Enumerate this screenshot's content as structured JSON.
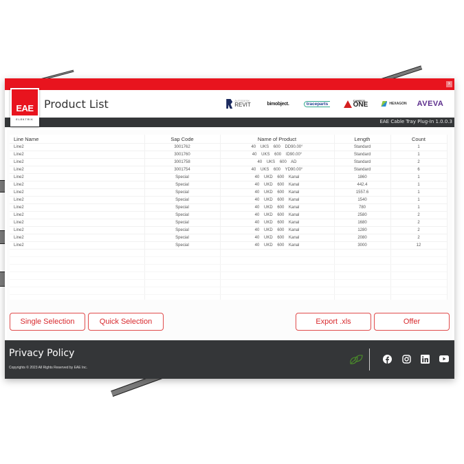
{
  "window": {
    "close_label": "x"
  },
  "header": {
    "logo_text": "EAE",
    "logo_subtext": "ELEKTRIK",
    "title": "Product List",
    "partners": {
      "revit_small": "AUTODESK",
      "revit_big": "REVIT",
      "bimobject": "bimobject.",
      "traceparts": "traceparts",
      "caneco_small": "CANECO",
      "caneco_big": "ONE",
      "hexagon": "HEXAGON",
      "aveva": "AVEVA"
    },
    "version": "EAE Cable Tray Plug-In 1.0.0.3"
  },
  "table": {
    "columns": [
      "Line Name",
      "Sap Code",
      "Name of Product",
      "Length",
      "Count"
    ],
    "rows": [
      {
        "line": "Line2",
        "sap": "3001762",
        "product": "40    UKS    600    DD90.00°",
        "length": "Standard",
        "count": "1"
      },
      {
        "line": "Line2",
        "sap": "3001760",
        "product": "40    UKS    600    ID90.00°",
        "length": "Standard",
        "count": "1"
      },
      {
        "line": "Line2",
        "sap": "3001758",
        "product": "40    UKS    600    AD",
        "length": "Standard",
        "count": "2"
      },
      {
        "line": "Line2",
        "sap": "3001754",
        "product": "40    UKS    600    YD90.00°",
        "length": "Standard",
        "count": "6"
      },
      {
        "line": "Line2",
        "sap": "Special",
        "product": "40    UKD    600    Kanal",
        "length": "1860",
        "count": "1"
      },
      {
        "line": "Line2",
        "sap": "Special",
        "product": "40    UKD    600    Kanal",
        "length": "442.4",
        "count": "1"
      },
      {
        "line": "Line2",
        "sap": "Special",
        "product": "40    UKD    600    Kanal",
        "length": "1557.6",
        "count": "1"
      },
      {
        "line": "Line2",
        "sap": "Special",
        "product": "40    UKD    600    Kanal",
        "length": "1540",
        "count": "1"
      },
      {
        "line": "Line2",
        "sap": "Special",
        "product": "40    UKD    600    Kanal",
        "length": "780",
        "count": "1"
      },
      {
        "line": "Line2",
        "sap": "Special",
        "product": "40    UKD    600    Kanal",
        "length": "2580",
        "count": "2"
      },
      {
        "line": "Line2",
        "sap": "Special",
        "product": "40    UKD    600    Kanal",
        "length": "1680",
        "count": "2"
      },
      {
        "line": "Line2",
        "sap": "Special",
        "product": "40    UKD    600    Kanal",
        "length": "1280",
        "count": "2"
      },
      {
        "line": "Line2",
        "sap": "Special",
        "product": "40    UKD    600    Kanal",
        "length": "2080",
        "count": "2"
      },
      {
        "line": "Line2",
        "sap": "Special",
        "product": "40    UKD    600    Kanal",
        "length": "3000",
        "count": "12"
      }
    ]
  },
  "buttons": {
    "single_selection": "Single Selection",
    "quick_selection": "Quick Selection",
    "export": "Export .xls",
    "offer": "Offer"
  },
  "footer": {
    "privacy": "Privacy Policy",
    "copyright": "Copyrights © 2023 All Rights Reserved by EAE Inc.",
    "social": [
      "facebook",
      "instagram",
      "linkedin",
      "youtube"
    ]
  },
  "colors": {
    "brand_red": "#e8141e",
    "dark_bar": "#343638",
    "button_text": "#d8282c",
    "leaf_green": "#4a8a2a"
  }
}
